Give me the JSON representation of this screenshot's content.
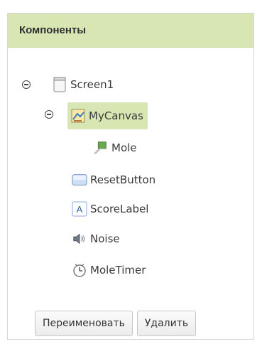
{
  "panel": {
    "title": "Компоненты"
  },
  "tree": {
    "screen": {
      "label": "Screen1",
      "icon": "screen-icon"
    },
    "canvas": {
      "label": "MyCanvas",
      "icon": "canvas-icon",
      "selected": true
    },
    "mole": {
      "label": "Mole",
      "icon": "image-sprite-icon"
    },
    "reset_button": {
      "label": "ResetButton",
      "icon": "button-icon"
    },
    "score_label": {
      "label": "ScoreLabel",
      "icon": "label-icon"
    },
    "noise": {
      "label": "Noise",
      "icon": "sound-icon"
    },
    "mole_timer": {
      "label": "MoleTimer",
      "icon": "clock-icon"
    }
  },
  "actions": {
    "rename_label": "Переименовать",
    "delete_label": "Удалить"
  },
  "colors": {
    "header_bg": "#d7e6b3",
    "selected_bg": "#d7e6b3"
  }
}
